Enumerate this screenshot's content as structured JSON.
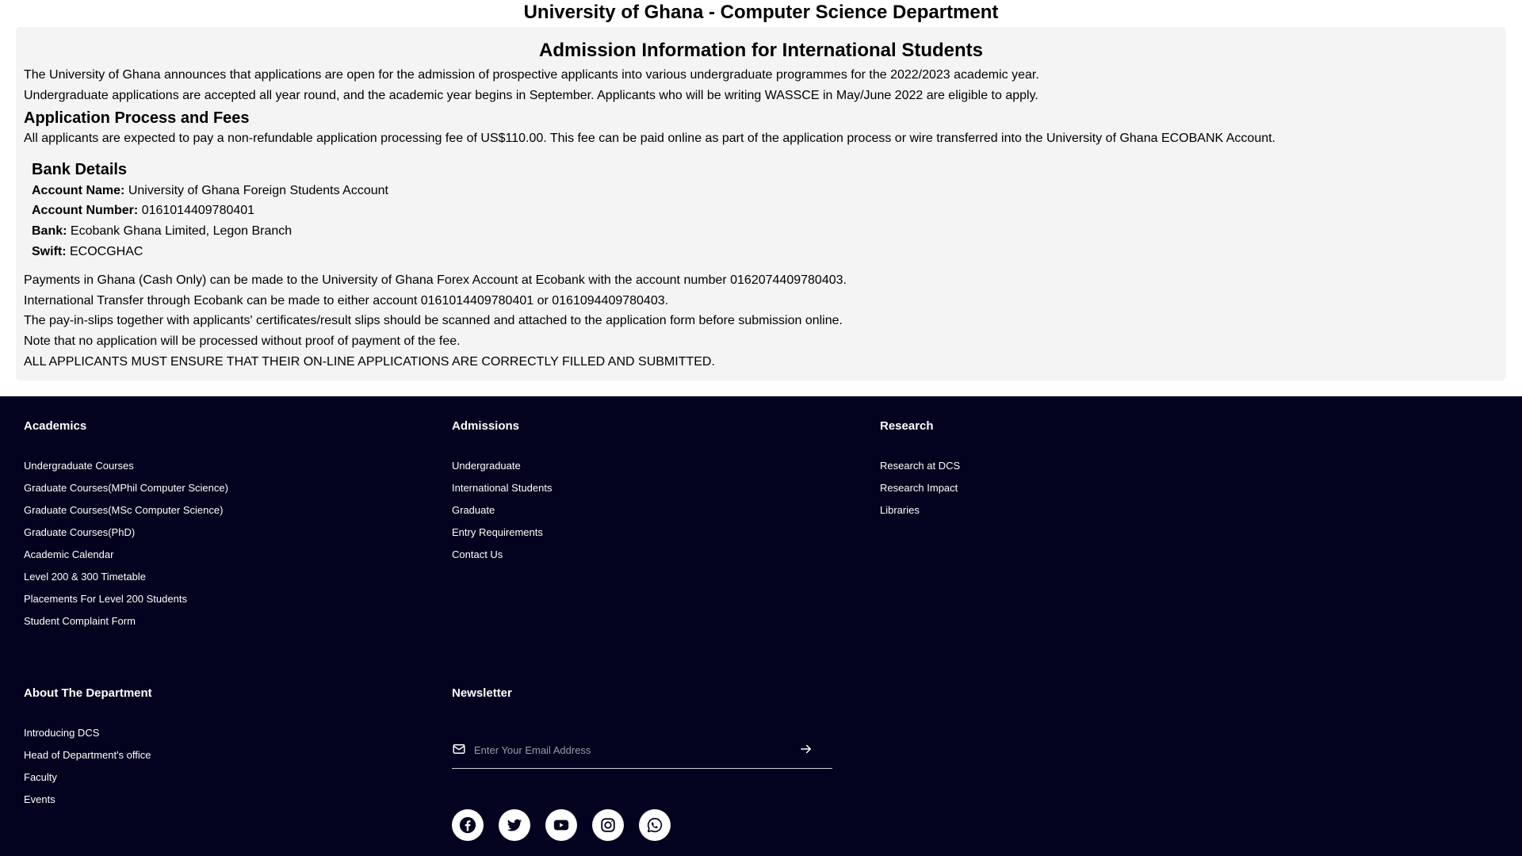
{
  "site_title": "University of Ghana - Computer Science Department",
  "info": {
    "heading": "Admission Information for International Students",
    "intro": [
      "The University of Ghana announces that applications are open for the admission of prospective applicants into various undergraduate programmes for the 2022/2023 academic year.",
      "Undergraduate applications are accepted all year round, and the academic year begins in September. Applicants who will be writing WASSCE in May/June 2022 are eligible to apply."
    ],
    "process_heading": "Application Process and Fees",
    "process_text": "All applicants are expected to pay a non-refundable application processing fee of US$110.00. This fee can be paid online as part of the application process or wire transferred into the University of Ghana ECOBANK Account.",
    "bank": {
      "heading": "Bank Details",
      "rows": [
        {
          "label": "Account Name:",
          "value": "University of Ghana Foreign Students Account"
        },
        {
          "label": "Account Number:",
          "value": "0161014409780401"
        },
        {
          "label": "Bank:",
          "value": "Ecobank Ghana Limited, Legon Branch"
        },
        {
          "label": "Swift:",
          "value": "ECOCGHAC"
        }
      ]
    },
    "notes": [
      "Payments in Ghana (Cash Only) can be made to the University of Ghana Forex Account at Ecobank with the account number 0162074409780403.",
      "International Transfer through Ecobank can be made to either account 0161014409780401 or 0161094409780403.",
      "The pay-in-slips together with applicants' certificates/result slips should be scanned and attached to the application form before submission online.",
      "Note that no application will be processed without proof of payment of the fee.",
      "ALL APPLICANTS MUST ENSURE THAT THEIR ON-LINE APPLICATIONS ARE CORRECTLY FILLED AND SUBMITTED."
    ]
  },
  "footer": {
    "academics": {
      "title": "Academics",
      "links": [
        "Undergraduate Courses",
        "Graduate Courses(MPhil Computer Science)",
        "Graduate Courses(MSc Computer Science)",
        "Graduate Courses(PhD)",
        "Academic Calendar",
        "Level 200 & 300 Timetable",
        "Placements For Level 200 Students",
        "Student Complaint Form"
      ]
    },
    "admissions": {
      "title": "Admissions",
      "links": [
        "Undergraduate",
        "International Students",
        "Graduate",
        "Entry Requirements",
        "Contact Us"
      ]
    },
    "research": {
      "title": "Research",
      "links": [
        "Research at DCS",
        "Research Impact",
        "Libraries"
      ]
    },
    "about": {
      "title": "About The Department",
      "links": [
        "Introducing DCS",
        "Head of Department's office",
        "Faculty",
        "Events"
      ]
    },
    "newsletter": {
      "title": "Newsletter",
      "email_value": "",
      "email_placeholder": "Enter Your Email Address",
      "mail_icon": "envelope-icon",
      "submit_icon": "arrow-right-icon"
    },
    "social_icons": [
      "facebook-icon",
      "twitter-icon",
      "youtube-icon",
      "instagram-icon",
      "whatsapp-icon"
    ],
    "colors": {
      "background": "#03031f",
      "text": "#ffffff"
    }
  }
}
